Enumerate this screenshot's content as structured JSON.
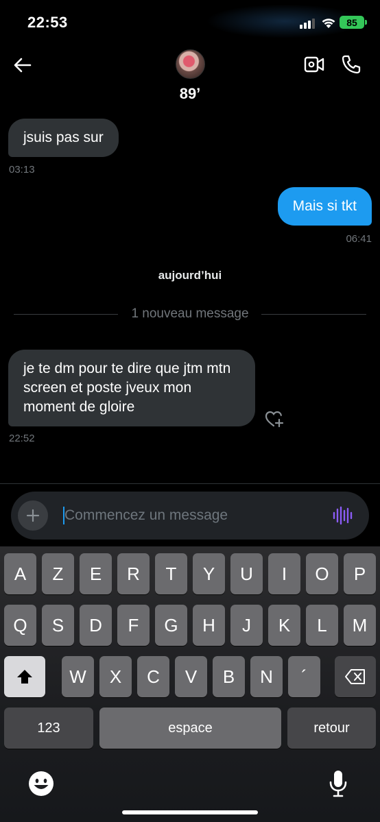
{
  "status_bar": {
    "time": "22:53",
    "battery": "85"
  },
  "header": {
    "contact_name": "89’"
  },
  "messages": [
    {
      "direction": "in",
      "text": "jsuis pas sur",
      "time": "03:13"
    },
    {
      "direction": "out",
      "text": "Mais si tkt",
      "time": "06:41"
    },
    {
      "direction": "in",
      "text": "je te dm pour te dire que jtm mtn screen et poste jveux mon moment de gloire",
      "time": "22:52"
    }
  ],
  "day_separator": "aujourd’hui",
  "new_message_divider": "1 nouveau message",
  "composer": {
    "placeholder": "Commencez un message",
    "value": ""
  },
  "keyboard": {
    "row1": [
      "A",
      "Z",
      "E",
      "R",
      "T",
      "Y",
      "U",
      "I",
      "O",
      "P"
    ],
    "row2": [
      "Q",
      "S",
      "D",
      "F",
      "G",
      "H",
      "J",
      "K",
      "L",
      "M"
    ],
    "row3": [
      "W",
      "X",
      "C",
      "V",
      "B",
      "N",
      "´"
    ],
    "numbers_label": "123",
    "space_label": "espace",
    "return_label": "retour"
  },
  "colors": {
    "accent": "#1d9bf0",
    "incoming_bubble": "#2f3336",
    "voice_icon": "#8b5cf6",
    "battery": "#34c759"
  },
  "icons": [
    "back-arrow-icon",
    "video-call-icon",
    "phone-icon",
    "add-react-icon",
    "plus-icon",
    "voice-waveform-icon",
    "shift-icon",
    "backspace-icon",
    "emoji-icon",
    "microphone-icon"
  ]
}
